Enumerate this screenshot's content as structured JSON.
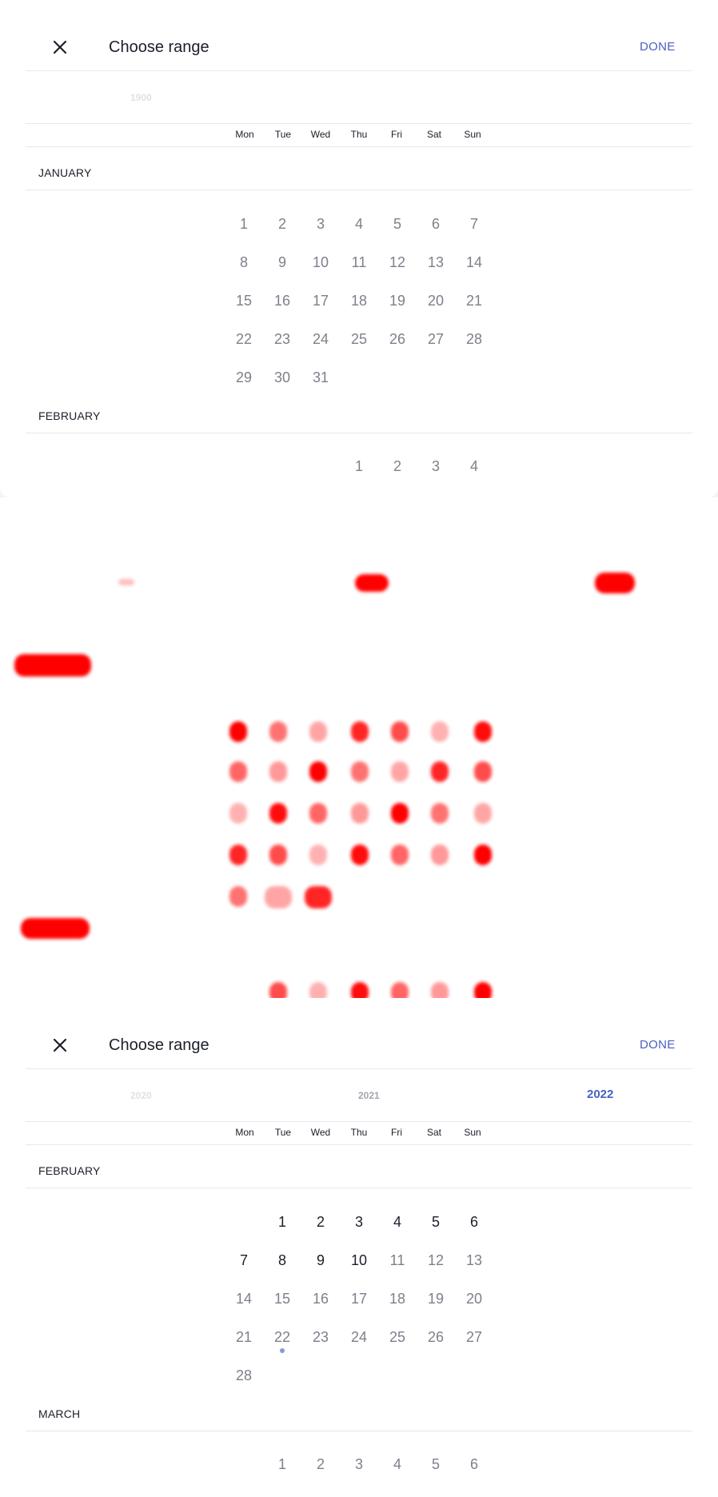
{
  "colors": {
    "accent": "#4a5fc1",
    "diff_mark": "#ff0000",
    "today_dot": "#8898e0"
  },
  "before": {
    "title": "Choose range",
    "done_label": "DONE",
    "year_visible": "1900",
    "weekdays": [
      "Mon",
      "Tue",
      "Wed",
      "Thu",
      "Fri",
      "Sat",
      "Sun"
    ],
    "months": [
      {
        "name": "JANUARY",
        "first_weekday_index": 0,
        "days": [
          "1",
          "2",
          "3",
          "4",
          "5",
          "6",
          "7",
          "8",
          "9",
          "10",
          "11",
          "12",
          "13",
          "14",
          "15",
          "16",
          "17",
          "18",
          "19",
          "20",
          "21",
          "22",
          "23",
          "24",
          "25",
          "26",
          "27",
          "28",
          "29",
          "30",
          "31"
        ]
      },
      {
        "name": "FEBRUARY",
        "first_weekday_index": 3,
        "days": [
          "1",
          "2",
          "3",
          "4"
        ]
      }
    ]
  },
  "after": {
    "title": "Choose range",
    "done_label": "DONE",
    "years": [
      {
        "label": "2020",
        "state": "faded"
      },
      {
        "label": "2021",
        "state": "dim"
      },
      {
        "label": "2022",
        "state": "selected"
      }
    ],
    "weekdays": [
      "Mon",
      "Tue",
      "Wed",
      "Thu",
      "Fri",
      "Sat",
      "Sun"
    ],
    "today": "22",
    "months": [
      {
        "name": "FEBRUARY",
        "first_weekday_index": 1,
        "active_through": 10,
        "days": [
          "1",
          "2",
          "3",
          "4",
          "5",
          "6",
          "7",
          "8",
          "9",
          "10",
          "11",
          "12",
          "13",
          "14",
          "15",
          "16",
          "17",
          "18",
          "19",
          "20",
          "21",
          "22",
          "23",
          "24",
          "25",
          "26",
          "27",
          "28"
        ]
      },
      {
        "name": "MARCH",
        "first_weekday_index": 1,
        "active_through": 0,
        "days": [
          "1",
          "2",
          "3",
          "4",
          "5",
          "6"
        ]
      }
    ]
  }
}
